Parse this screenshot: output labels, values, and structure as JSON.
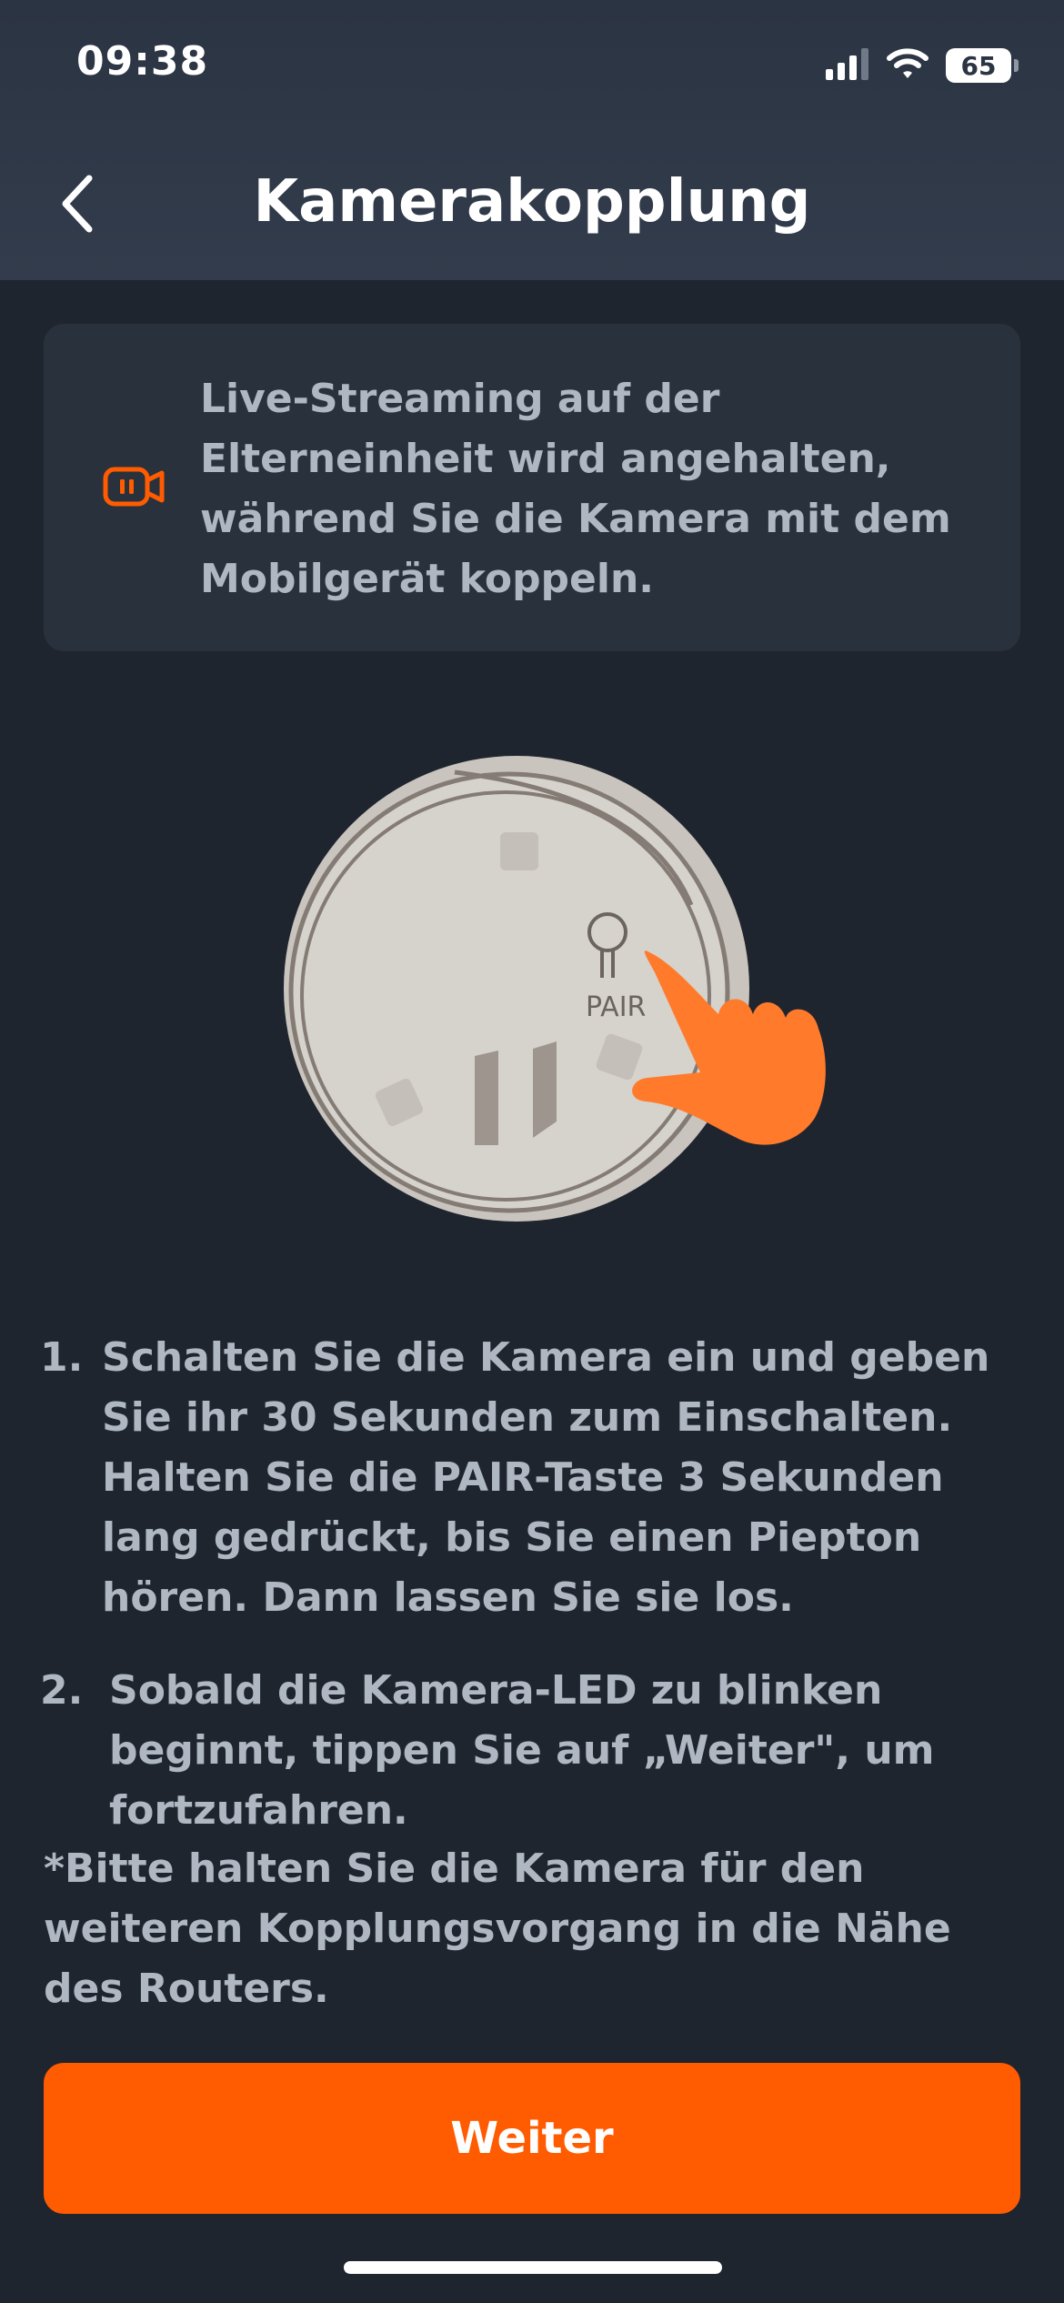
{
  "status_bar": {
    "time": "09:38",
    "battery": "65",
    "icons": [
      "signal-icon",
      "wifi-icon",
      "battery-icon"
    ]
  },
  "header": {
    "title": "Kamerakopplung",
    "back_icon": "chevron-left-icon"
  },
  "notice": {
    "icon": "camera-paused-icon",
    "lines": [
      "Live-Streaming auf der",
      "Elterneinheit wird angehalten,",
      "während Sie die Kamera mit dem",
      "Mobilgerät koppeln."
    ]
  },
  "illustration": {
    "button_label": "PAIR"
  },
  "steps": [
    {
      "number": "1.",
      "lines": [
        "Schalten Sie die Kamera ein und geben",
        "Sie ihr 30 Sekunden zum Einschalten.",
        "Halten Sie die PAIR-Taste 3 Sekunden",
        "lang gedrückt, bis Sie einen Piepton",
        "hören. Dann lassen Sie sie los."
      ]
    },
    {
      "number": "2.",
      "lines": [
        "Sobald die Kamera-LED zu blinken",
        "beginnt, tippen Sie auf „Weiter\", um",
        "fortzufahren."
      ]
    }
  ],
  "note": {
    "lines": [
      "*Bitte halten Sie die Kamera für den",
      "weiteren Kopplungsvorgang in die Nähe",
      "des Routers."
    ]
  },
  "continue_button": {
    "label": "Weiter"
  },
  "colors": {
    "accent": "#ff5b00",
    "background": "#1f252e",
    "header": "#2b3442",
    "card": "#29313c",
    "text": "#aeb7c2"
  }
}
